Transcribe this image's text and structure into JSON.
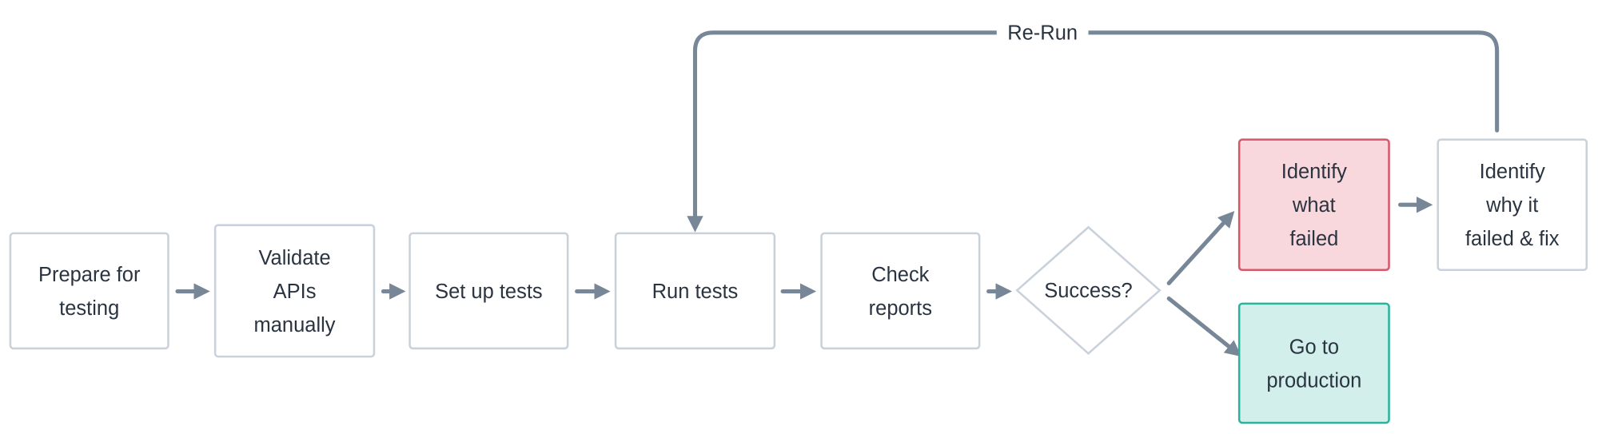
{
  "colors": {
    "edge": "#778797",
    "node_border": "#c9d1da",
    "failed_fill": "#f8d8dc",
    "failed_border": "#d5586a",
    "success_fill": "#d2efec",
    "success_border": "#2bb39e",
    "text": "#2a3441"
  },
  "nodes": [
    {
      "id": "prepare",
      "lines": [
        "Prepare for",
        "testing"
      ]
    },
    {
      "id": "validate",
      "lines": [
        "Validate",
        "APIs",
        "manually"
      ]
    },
    {
      "id": "setup",
      "lines": [
        "Set up tests"
      ]
    },
    {
      "id": "run",
      "lines": [
        "Run tests"
      ]
    },
    {
      "id": "check",
      "lines": [
        "Check",
        "reports"
      ]
    },
    {
      "id": "success",
      "lines": [
        "Success?"
      ],
      "shape": "diamond"
    },
    {
      "id": "identify-what",
      "lines": [
        "Identify",
        "what",
        "failed"
      ]
    },
    {
      "id": "identify-why",
      "lines": [
        "Identify",
        "why it",
        "failed & fix"
      ]
    },
    {
      "id": "production",
      "lines": [
        "Go to",
        "production"
      ]
    }
  ],
  "edges": [
    {
      "from": "prepare",
      "to": "validate"
    },
    {
      "from": "validate",
      "to": "setup"
    },
    {
      "from": "setup",
      "to": "run"
    },
    {
      "from": "run",
      "to": "check"
    },
    {
      "from": "check",
      "to": "success"
    },
    {
      "from": "success",
      "to": "identify-what"
    },
    {
      "from": "success",
      "to": "production"
    },
    {
      "from": "identify-what",
      "to": "identify-why"
    },
    {
      "from": "identify-why",
      "to": "run",
      "label": "Re-Run"
    }
  ]
}
